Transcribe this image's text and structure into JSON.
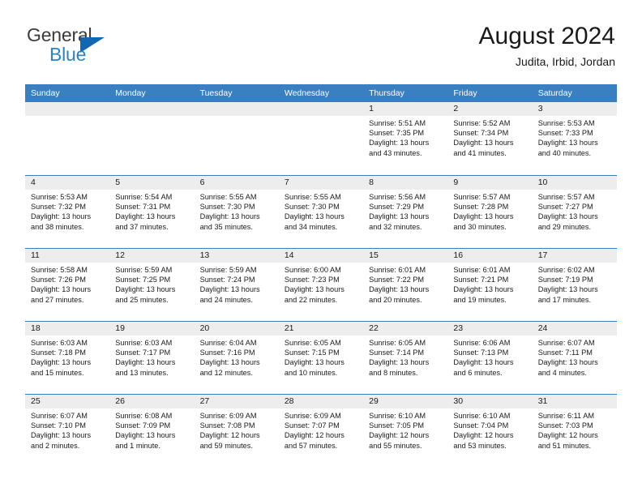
{
  "brand": {
    "word1": "General",
    "word2": "Blue",
    "logo_color": "#1167b1",
    "blue_text_color": "#2c83c3"
  },
  "header": {
    "title": "August 2024",
    "subtitle": "Judita, Irbid, Jordan"
  },
  "calendar": {
    "accent_color": "#3a7fc1",
    "shaded_color": "#ededed",
    "weekdays": [
      "Sunday",
      "Monday",
      "Tuesday",
      "Wednesday",
      "Thursday",
      "Friday",
      "Saturday"
    ],
    "weeks": [
      [
        {
          "day": "",
          "sunrise": "",
          "sunset": "",
          "daylight1": "",
          "daylight2": "",
          "shaded": true,
          "empty": true
        },
        {
          "day": "",
          "sunrise": "",
          "sunset": "",
          "daylight1": "",
          "daylight2": "",
          "shaded": true,
          "empty": true
        },
        {
          "day": "",
          "sunrise": "",
          "sunset": "",
          "daylight1": "",
          "daylight2": "",
          "shaded": true,
          "empty": true
        },
        {
          "day": "",
          "sunrise": "",
          "sunset": "",
          "daylight1": "",
          "daylight2": "",
          "shaded": true,
          "empty": true
        },
        {
          "day": "1",
          "sunrise": "Sunrise: 5:51 AM",
          "sunset": "Sunset: 7:35 PM",
          "daylight1": "Daylight: 13 hours",
          "daylight2": "and 43 minutes.",
          "shaded": true,
          "empty": false
        },
        {
          "day": "2",
          "sunrise": "Sunrise: 5:52 AM",
          "sunset": "Sunset: 7:34 PM",
          "daylight1": "Daylight: 13 hours",
          "daylight2": "and 41 minutes.",
          "shaded": true,
          "empty": false
        },
        {
          "day": "3",
          "sunrise": "Sunrise: 5:53 AM",
          "sunset": "Sunset: 7:33 PM",
          "daylight1": "Daylight: 13 hours",
          "daylight2": "and 40 minutes.",
          "shaded": true,
          "empty": false
        }
      ],
      [
        {
          "day": "4",
          "sunrise": "Sunrise: 5:53 AM",
          "sunset": "Sunset: 7:32 PM",
          "daylight1": "Daylight: 13 hours",
          "daylight2": "and 38 minutes.",
          "shaded": true,
          "empty": false
        },
        {
          "day": "5",
          "sunrise": "Sunrise: 5:54 AM",
          "sunset": "Sunset: 7:31 PM",
          "daylight1": "Daylight: 13 hours",
          "daylight2": "and 37 minutes.",
          "shaded": true,
          "empty": false
        },
        {
          "day": "6",
          "sunrise": "Sunrise: 5:55 AM",
          "sunset": "Sunset: 7:30 PM",
          "daylight1": "Daylight: 13 hours",
          "daylight2": "and 35 minutes.",
          "shaded": true,
          "empty": false
        },
        {
          "day": "7",
          "sunrise": "Sunrise: 5:55 AM",
          "sunset": "Sunset: 7:30 PM",
          "daylight1": "Daylight: 13 hours",
          "daylight2": "and 34 minutes.",
          "shaded": true,
          "empty": false
        },
        {
          "day": "8",
          "sunrise": "Sunrise: 5:56 AM",
          "sunset": "Sunset: 7:29 PM",
          "daylight1": "Daylight: 13 hours",
          "daylight2": "and 32 minutes.",
          "shaded": true,
          "empty": false
        },
        {
          "day": "9",
          "sunrise": "Sunrise: 5:57 AM",
          "sunset": "Sunset: 7:28 PM",
          "daylight1": "Daylight: 13 hours",
          "daylight2": "and 30 minutes.",
          "shaded": true,
          "empty": false
        },
        {
          "day": "10",
          "sunrise": "Sunrise: 5:57 AM",
          "sunset": "Sunset: 7:27 PM",
          "daylight1": "Daylight: 13 hours",
          "daylight2": "and 29 minutes.",
          "shaded": true,
          "empty": false
        }
      ],
      [
        {
          "day": "11",
          "sunrise": "Sunrise: 5:58 AM",
          "sunset": "Sunset: 7:26 PM",
          "daylight1": "Daylight: 13 hours",
          "daylight2": "and 27 minutes.",
          "shaded": true,
          "empty": false
        },
        {
          "day": "12",
          "sunrise": "Sunrise: 5:59 AM",
          "sunset": "Sunset: 7:25 PM",
          "daylight1": "Daylight: 13 hours",
          "daylight2": "and 25 minutes.",
          "shaded": true,
          "empty": false
        },
        {
          "day": "13",
          "sunrise": "Sunrise: 5:59 AM",
          "sunset": "Sunset: 7:24 PM",
          "daylight1": "Daylight: 13 hours",
          "daylight2": "and 24 minutes.",
          "shaded": true,
          "empty": false
        },
        {
          "day": "14",
          "sunrise": "Sunrise: 6:00 AM",
          "sunset": "Sunset: 7:23 PM",
          "daylight1": "Daylight: 13 hours",
          "daylight2": "and 22 minutes.",
          "shaded": true,
          "empty": false
        },
        {
          "day": "15",
          "sunrise": "Sunrise: 6:01 AM",
          "sunset": "Sunset: 7:22 PM",
          "daylight1": "Daylight: 13 hours",
          "daylight2": "and 20 minutes.",
          "shaded": true,
          "empty": false
        },
        {
          "day": "16",
          "sunrise": "Sunrise: 6:01 AM",
          "sunset": "Sunset: 7:21 PM",
          "daylight1": "Daylight: 13 hours",
          "daylight2": "and 19 minutes.",
          "shaded": true,
          "empty": false
        },
        {
          "day": "17",
          "sunrise": "Sunrise: 6:02 AM",
          "sunset": "Sunset: 7:19 PM",
          "daylight1": "Daylight: 13 hours",
          "daylight2": "and 17 minutes.",
          "shaded": true,
          "empty": false
        }
      ],
      [
        {
          "day": "18",
          "sunrise": "Sunrise: 6:03 AM",
          "sunset": "Sunset: 7:18 PM",
          "daylight1": "Daylight: 13 hours",
          "daylight2": "and 15 minutes.",
          "shaded": true,
          "empty": false
        },
        {
          "day": "19",
          "sunrise": "Sunrise: 6:03 AM",
          "sunset": "Sunset: 7:17 PM",
          "daylight1": "Daylight: 13 hours",
          "daylight2": "and 13 minutes.",
          "shaded": true,
          "empty": false
        },
        {
          "day": "20",
          "sunrise": "Sunrise: 6:04 AM",
          "sunset": "Sunset: 7:16 PM",
          "daylight1": "Daylight: 13 hours",
          "daylight2": "and 12 minutes.",
          "shaded": true,
          "empty": false
        },
        {
          "day": "21",
          "sunrise": "Sunrise: 6:05 AM",
          "sunset": "Sunset: 7:15 PM",
          "daylight1": "Daylight: 13 hours",
          "daylight2": "and 10 minutes.",
          "shaded": true,
          "empty": false
        },
        {
          "day": "22",
          "sunrise": "Sunrise: 6:05 AM",
          "sunset": "Sunset: 7:14 PM",
          "daylight1": "Daylight: 13 hours",
          "daylight2": "and 8 minutes.",
          "shaded": true,
          "empty": false
        },
        {
          "day": "23",
          "sunrise": "Sunrise: 6:06 AM",
          "sunset": "Sunset: 7:13 PM",
          "daylight1": "Daylight: 13 hours",
          "daylight2": "and 6 minutes.",
          "shaded": true,
          "empty": false
        },
        {
          "day": "24",
          "sunrise": "Sunrise: 6:07 AM",
          "sunset": "Sunset: 7:11 PM",
          "daylight1": "Daylight: 13 hours",
          "daylight2": "and 4 minutes.",
          "shaded": true,
          "empty": false
        }
      ],
      [
        {
          "day": "25",
          "sunrise": "Sunrise: 6:07 AM",
          "sunset": "Sunset: 7:10 PM",
          "daylight1": "Daylight: 13 hours",
          "daylight2": "and 2 minutes.",
          "shaded": true,
          "empty": false
        },
        {
          "day": "26",
          "sunrise": "Sunrise: 6:08 AM",
          "sunset": "Sunset: 7:09 PM",
          "daylight1": "Daylight: 13 hours",
          "daylight2": "and 1 minute.",
          "shaded": true,
          "empty": false
        },
        {
          "day": "27",
          "sunrise": "Sunrise: 6:09 AM",
          "sunset": "Sunset: 7:08 PM",
          "daylight1": "Daylight: 12 hours",
          "daylight2": "and 59 minutes.",
          "shaded": true,
          "empty": false
        },
        {
          "day": "28",
          "sunrise": "Sunrise: 6:09 AM",
          "sunset": "Sunset: 7:07 PM",
          "daylight1": "Daylight: 12 hours",
          "daylight2": "and 57 minutes.",
          "shaded": true,
          "empty": false
        },
        {
          "day": "29",
          "sunrise": "Sunrise: 6:10 AM",
          "sunset": "Sunset: 7:05 PM",
          "daylight1": "Daylight: 12 hours",
          "daylight2": "and 55 minutes.",
          "shaded": true,
          "empty": false
        },
        {
          "day": "30",
          "sunrise": "Sunrise: 6:10 AM",
          "sunset": "Sunset: 7:04 PM",
          "daylight1": "Daylight: 12 hours",
          "daylight2": "and 53 minutes.",
          "shaded": true,
          "empty": false
        },
        {
          "day": "31",
          "sunrise": "Sunrise: 6:11 AM",
          "sunset": "Sunset: 7:03 PM",
          "daylight1": "Daylight: 12 hours",
          "daylight2": "and 51 minutes.",
          "shaded": true,
          "empty": false
        }
      ]
    ]
  }
}
